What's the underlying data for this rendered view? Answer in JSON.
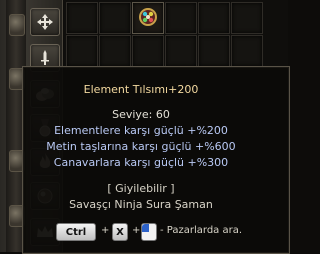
{
  "tooltip": {
    "item_name": "Element Tılsımı+200",
    "level": "Seviye: 60",
    "bonuses": [
      "Elementlere karşı güçlü +%200",
      "Metin taşlarına karşı güçlü +%600",
      "Canavarlara karşı güçlü +%300"
    ],
    "wearable": "[ Giyilebilir ]",
    "classes": "Savaşçı Ninja Sura Şaman",
    "shortcut": {
      "key1": "Ctrl",
      "plus1": "+",
      "key2": "X",
      "plus2": "+",
      "suffix": "- Pazarlarda ara."
    }
  },
  "toolbar": {
    "icons": [
      "move-arrows-icon",
      "sword-icon",
      "pouch-icon",
      "medal-icon",
      "flame-icon",
      "orb-icon",
      "crown-icon"
    ]
  },
  "colors": {
    "item_name": "#f3d9a0",
    "bonus": "#b9c9f4",
    "text": "#d8d4c8"
  }
}
